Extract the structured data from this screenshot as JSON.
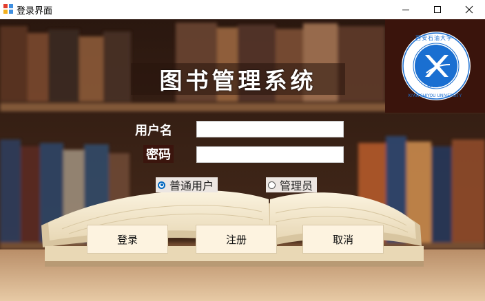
{
  "window": {
    "title": "登录界面"
  },
  "header": {
    "system_title": "图书管理系统"
  },
  "emblem": {
    "top_text": "西安石油大学",
    "en_text": "XI'AN SHIYOU UNIVERSITY",
    "year": "1951"
  },
  "form": {
    "username_label": "用户名",
    "username_value": "",
    "password_label": "密码",
    "password_value": ""
  },
  "roles": [
    {
      "label": "普通用户",
      "selected": true
    },
    {
      "label": "管理员",
      "selected": false
    }
  ],
  "buttons": {
    "login": "登录",
    "register": "注册",
    "cancel": "取消"
  },
  "colors": {
    "accent": "#0067c0",
    "button_bg": "#fdf3e0",
    "emblem_bg": "#3a140c",
    "emblem_blue": "#1a6fd1"
  }
}
